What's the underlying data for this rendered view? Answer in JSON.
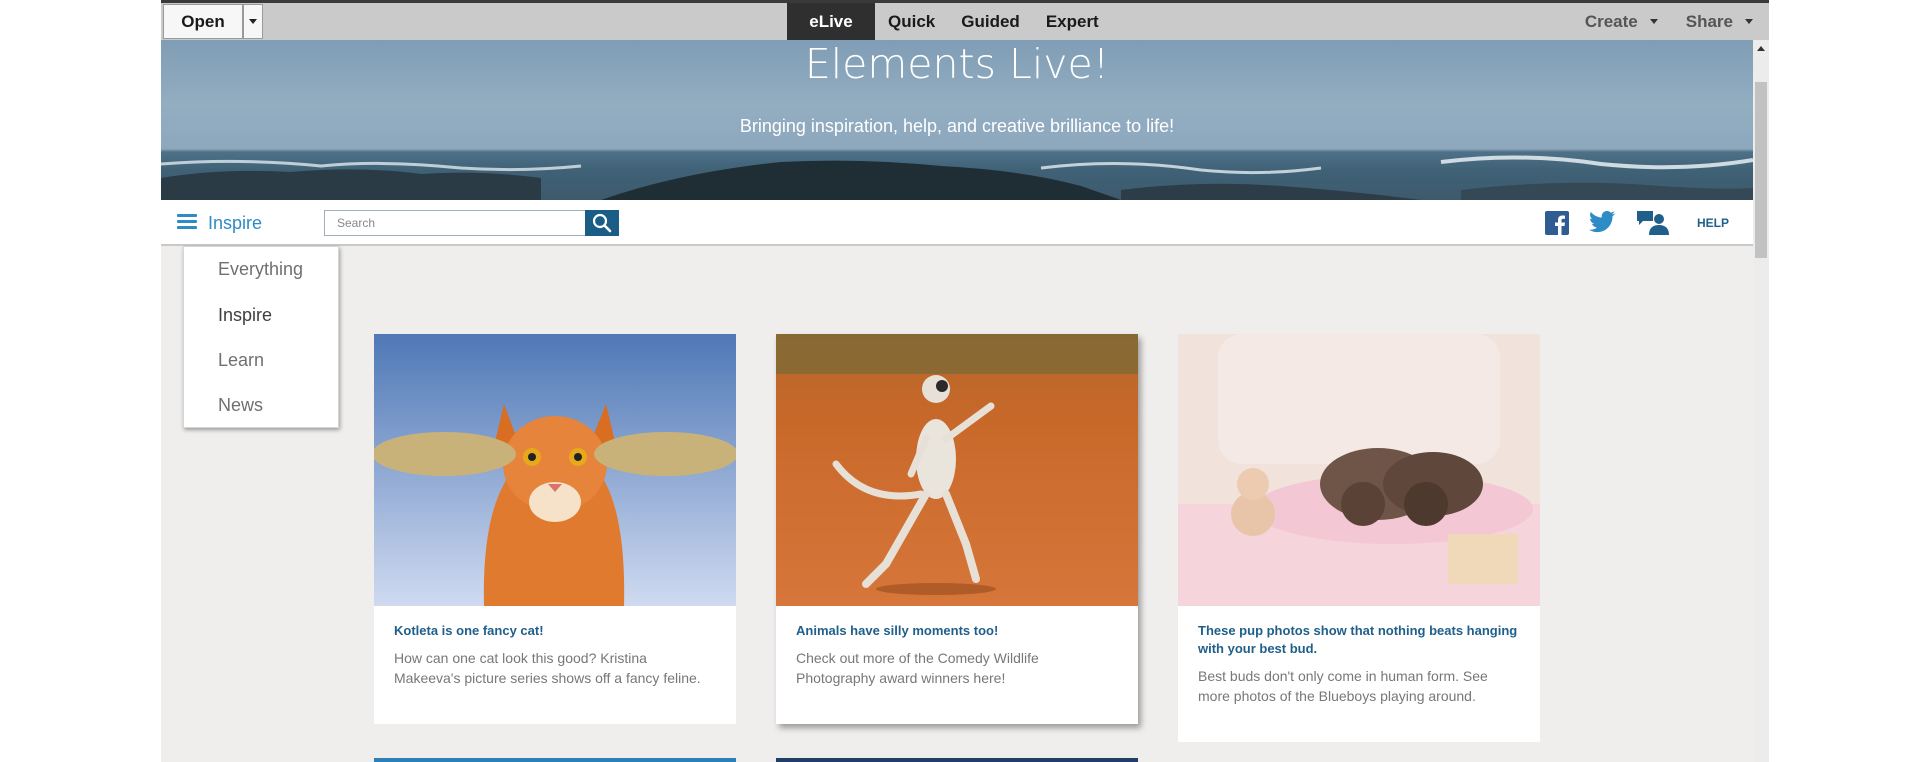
{
  "toolbar": {
    "open_label": "Open",
    "modes": [
      "eLive",
      "Quick",
      "Guided",
      "Expert"
    ],
    "active_mode": "eLive",
    "create_label": "Create",
    "share_label": "Share"
  },
  "banner": {
    "title": "Elements Live!",
    "subtitle": "Bringing inspiration, help, and creative brilliance to life!"
  },
  "nav": {
    "category": "Inspire",
    "search_placeholder": "Search",
    "social_icons": [
      "facebook-icon",
      "twitter-icon",
      "community-icon"
    ],
    "help_label": "HELP"
  },
  "dropdown": {
    "items": [
      "Everything",
      "Inspire",
      "Learn",
      "News"
    ],
    "selected": "Inspire"
  },
  "cards": [
    {
      "title": "Kotleta is one fancy cat!",
      "description": "How can one cat look this good? Kristina Makeeva's picture series shows off a fancy feline.",
      "image": "cat-with-fish"
    },
    {
      "title": "Animals have silly moments too!",
      "description": "Check out more of the Comedy Wildlife Photography award winners here!",
      "image": "dancing-lemur"
    },
    {
      "title": "These pup photos show that nothing beats hanging with your best bud.",
      "description": "Best buds don't only come in human form. See more photos of the Blueboys playing around.",
      "image": "sleeping-dogs"
    }
  ],
  "colors": {
    "accent": "#2d8bc5",
    "link": "#1f5f8a",
    "search_button": "#1a5d86",
    "active_tab": "#2f2f2f"
  }
}
